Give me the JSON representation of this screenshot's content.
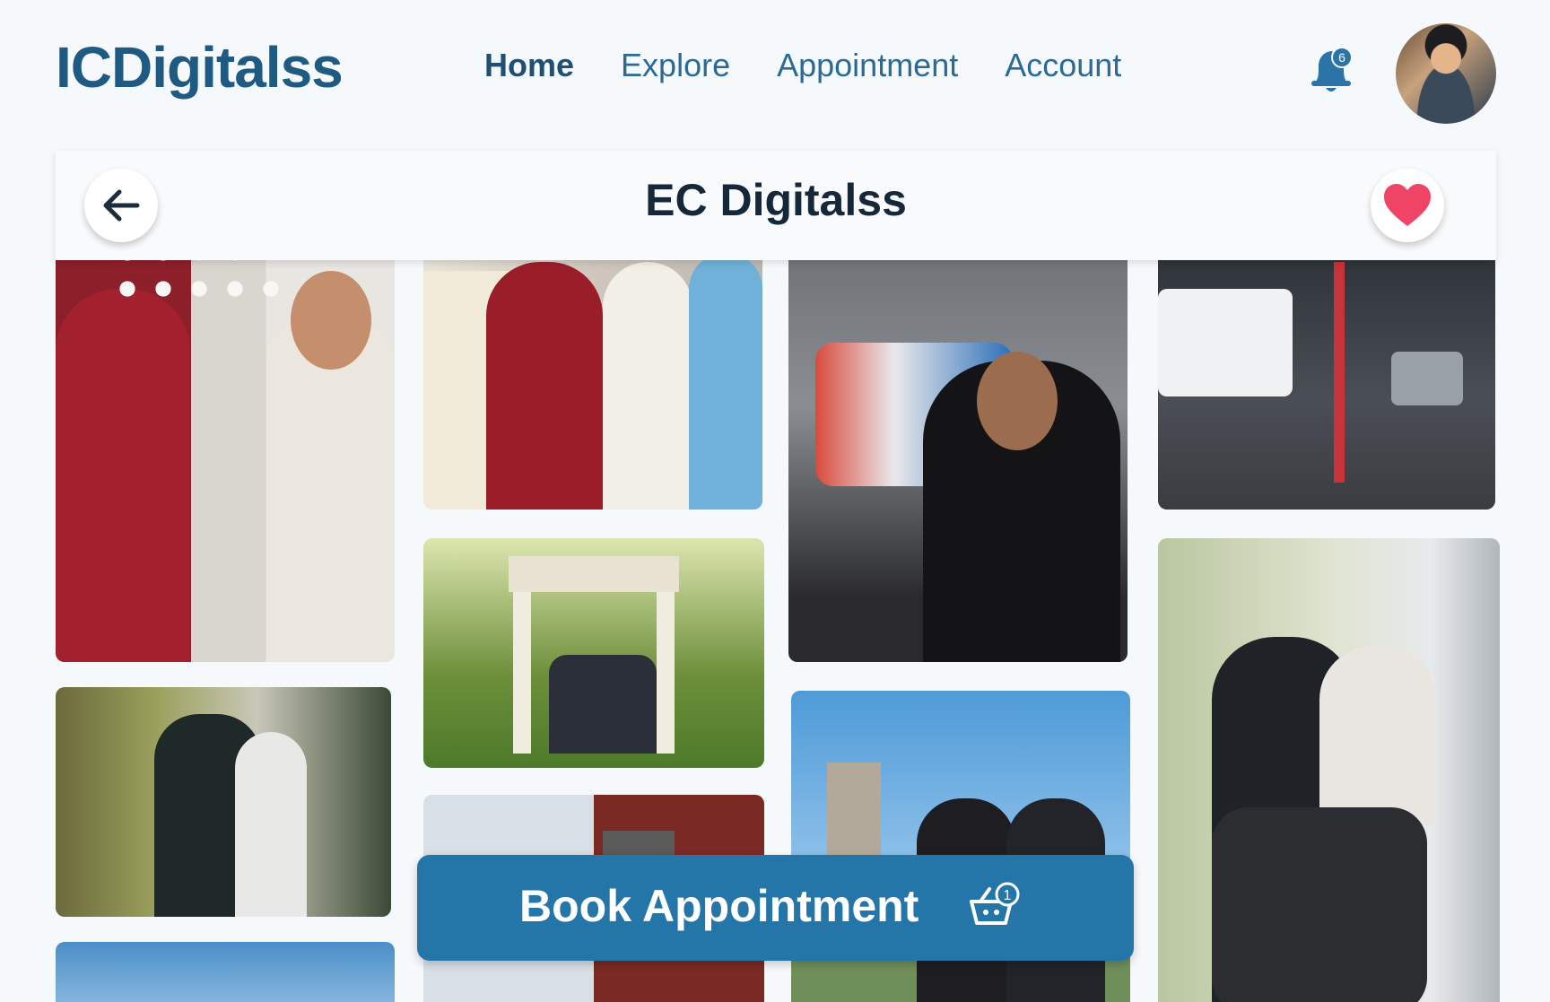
{
  "brand": {
    "name": "ICDigitalss"
  },
  "nav": {
    "items": [
      {
        "label": "Home",
        "active": true
      },
      {
        "label": "Explore",
        "active": false
      },
      {
        "label": "Appointment",
        "active": false
      },
      {
        "label": "Account",
        "active": false
      }
    ]
  },
  "notifications": {
    "count": "6",
    "icon": "bell-icon"
  },
  "profile": {
    "icon": "user-avatar"
  },
  "header": {
    "title": "EC Digitalss",
    "back_icon": "arrow-left-icon",
    "favorite_icon": "heart-icon"
  },
  "cta": {
    "label": "Book Appointment",
    "cart_count": "1",
    "icon": "basket-icon"
  },
  "colors": {
    "brand": "#1f5a82",
    "button": "#2576a8",
    "heart": "#ef4466",
    "bell": "#2b74a8"
  },
  "gallery": {
    "photos": [
      "wedding couple with rose",
      "family wedding portrait",
      "man with race car",
      "car repair garage",
      "couple kissing by fence",
      "group at gazebo",
      "couple on motorcycle",
      "two men at university",
      "brick building entrance",
      "sky landscape"
    ]
  }
}
